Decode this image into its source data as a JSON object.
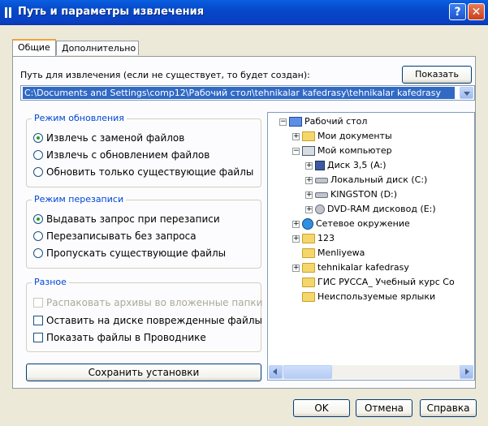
{
  "window": {
    "title": "Путь и параметры извлечения",
    "help_glyph": "?",
    "close_glyph": "✕"
  },
  "tabs": [
    {
      "label": "Общие",
      "active": true
    },
    {
      "label": "Дополнительно",
      "active": false
    }
  ],
  "path": {
    "label": "Путь для извлечения (если не существует, то будет создан):",
    "show_button": "Показать",
    "value": "C:\\Documents and Settings\\comp12\\Рабочий стол\\tehnikalar kafedrasy\\tehnikalar kafedrasy"
  },
  "update_mode": {
    "title": "Режим обновления",
    "options": [
      {
        "label": "Извлечь с заменой файлов",
        "checked": true
      },
      {
        "label": "Извлечь с обновлением файлов",
        "checked": false
      },
      {
        "label": "Обновить только существующие файлы",
        "checked": false
      }
    ]
  },
  "overwrite_mode": {
    "title": "Режим перезаписи",
    "options": [
      {
        "label": "Выдавать запрос при перезаписи",
        "checked": true
      },
      {
        "label": "Перезаписывать без запроса",
        "checked": false
      },
      {
        "label": "Пропускать существующие файлы",
        "checked": false
      }
    ]
  },
  "misc": {
    "title": "Разное",
    "options": [
      {
        "label": "Распаковать архивы во вложенные папки",
        "checked": false,
        "disabled": true
      },
      {
        "label": "Оставить на диске поврежденные файлы",
        "checked": false,
        "disabled": false
      },
      {
        "label": "Показать файлы в Проводнике",
        "checked": false,
        "disabled": false
      }
    ]
  },
  "save_button": "Сохранить установки",
  "tree": [
    {
      "label": "Рабочий стол",
      "icon": "desktop-icon",
      "toggle": "−"
    },
    {
      "label": "Мои документы",
      "icon": "documents-folder-icon",
      "toggle": "+"
    },
    {
      "label": "Мой компьютер",
      "icon": "computer-icon",
      "toggle": "−"
    },
    {
      "label": "Диск 3,5 (A:)",
      "icon": "floppy-drive-icon",
      "toggle": "+"
    },
    {
      "label": "Локальный диск (C:)",
      "icon": "hard-disk-icon",
      "toggle": "+"
    },
    {
      "label": "KINGSTON (D:)",
      "icon": "removable-disk-icon",
      "toggle": "+"
    },
    {
      "label": "DVD-RAM дисковод (E:)",
      "icon": "dvd-drive-icon",
      "toggle": "+"
    },
    {
      "label": "Сетевое окружение",
      "icon": "network-icon",
      "toggle": "+"
    },
    {
      "label": "123",
      "icon": "folder-icon",
      "toggle": "+"
    },
    {
      "label": "Menliyewa",
      "icon": "folder-icon",
      "toggle": ""
    },
    {
      "label": "tehnikalar kafedrasy",
      "icon": "folder-icon",
      "toggle": "+"
    },
    {
      "label": "ГИС РУССА_ Учебный курс Со",
      "icon": "folder-icon",
      "toggle": ""
    },
    {
      "label": "Неиспользуемые ярлыки",
      "icon": "folder-icon",
      "toggle": ""
    }
  ],
  "buttons": {
    "ok": "OK",
    "cancel": "Отмена",
    "help": "Справка"
  }
}
